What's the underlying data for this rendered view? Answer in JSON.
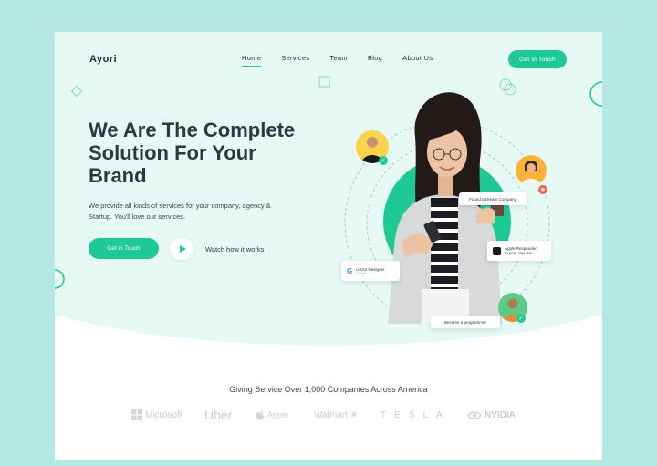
{
  "brand": {
    "name": "Ayori",
    "accent": "#1fc994",
    "outer_bg": "#b4e8e0",
    "hero_bg": "#e6f9f5"
  },
  "nav": {
    "items": [
      {
        "label": "Home",
        "active": true
      },
      {
        "label": "Services",
        "active": false
      },
      {
        "label": "Team",
        "active": false
      },
      {
        "label": "Blog",
        "active": false
      },
      {
        "label": "About Us",
        "active": false
      }
    ],
    "cta_label": "Get in Touch"
  },
  "hero": {
    "headline_line1": "We Are The Complete",
    "headline_line2": "Solution For Your",
    "headline_line3": "Brand",
    "description_line1": "We provide all kinds of services for your company, agency &",
    "description_line2": "Startup. You'll love our services.",
    "cta_label": "Get in Touch",
    "watch_label": "Watch how it works"
  },
  "illustration": {
    "cards": {
      "found_dream": "Found a Dream Company",
      "apple_title": "Apple Responded",
      "apple_sub": "to your resume",
      "google_title": "UX/UI Designer",
      "google_sub": "Google",
      "programmer": "Became a programmer"
    },
    "icons": [
      "check-icon",
      "star-icon",
      "apple-icon",
      "google-icon"
    ]
  },
  "companies": {
    "title": "Giving Service Over 1,000 Companies Across America",
    "logos": [
      "Microsoft",
      "Uber",
      "Apple",
      "Walmart",
      "TESLA",
      "NVIDIA"
    ]
  }
}
